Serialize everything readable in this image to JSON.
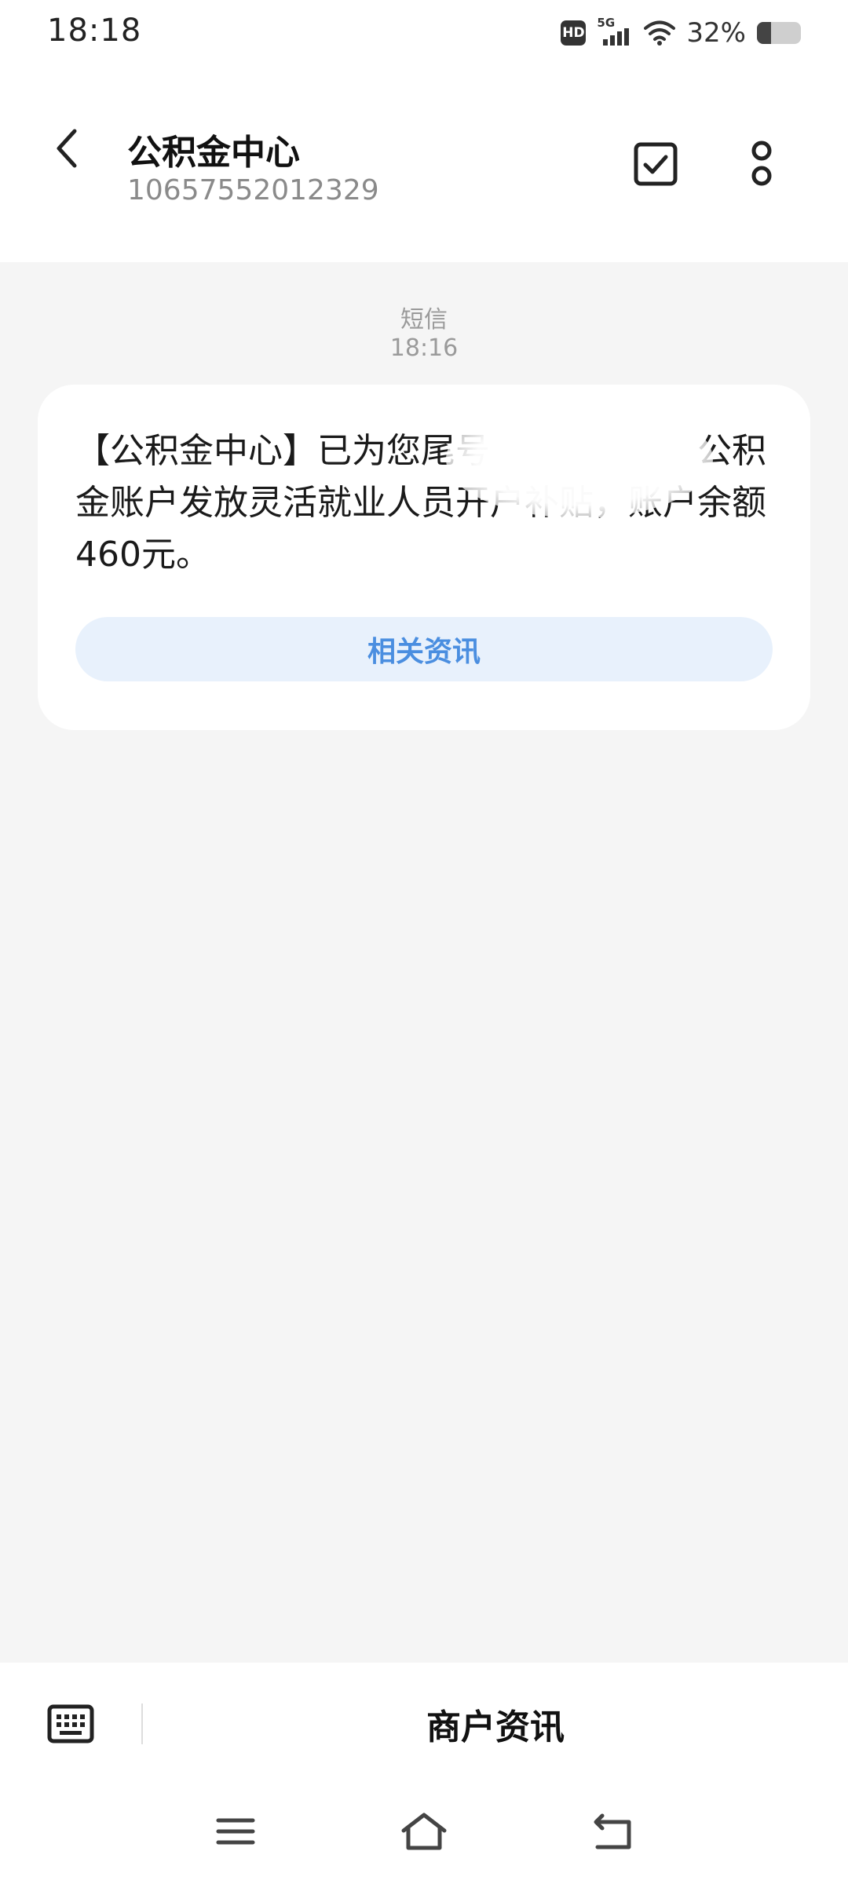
{
  "status_bar": {
    "time": "18:18",
    "hd_label": "HD",
    "network_label": "5G",
    "battery_percent": "32%",
    "battery_level": 0.32
  },
  "header": {
    "title": "公积金中心",
    "subtitle": "10657552012329",
    "back_icon": "chevron-left-icon",
    "select_icon": "checkbox-icon",
    "more_icon": "more-vertical-icon"
  },
  "conversation": {
    "message_type": "短信",
    "message_time": "18:16",
    "message_text": "【公积金中心】已为您尾号　　　　　　公积金账户发放灵活就业人员开户补贴，账户余额460元。",
    "action_button": "相关资讯"
  },
  "bottom_bar": {
    "keyboard_icon": "keyboard-icon",
    "merchant_label": "商户资讯"
  },
  "nav_bar": {
    "menu_icon": "menu-icon",
    "home_icon": "home-icon",
    "back_icon": "back-icon"
  },
  "colors": {
    "accent": "#4a8ee0",
    "accent_bg": "#e8f1fc",
    "background": "#f5f5f5"
  }
}
